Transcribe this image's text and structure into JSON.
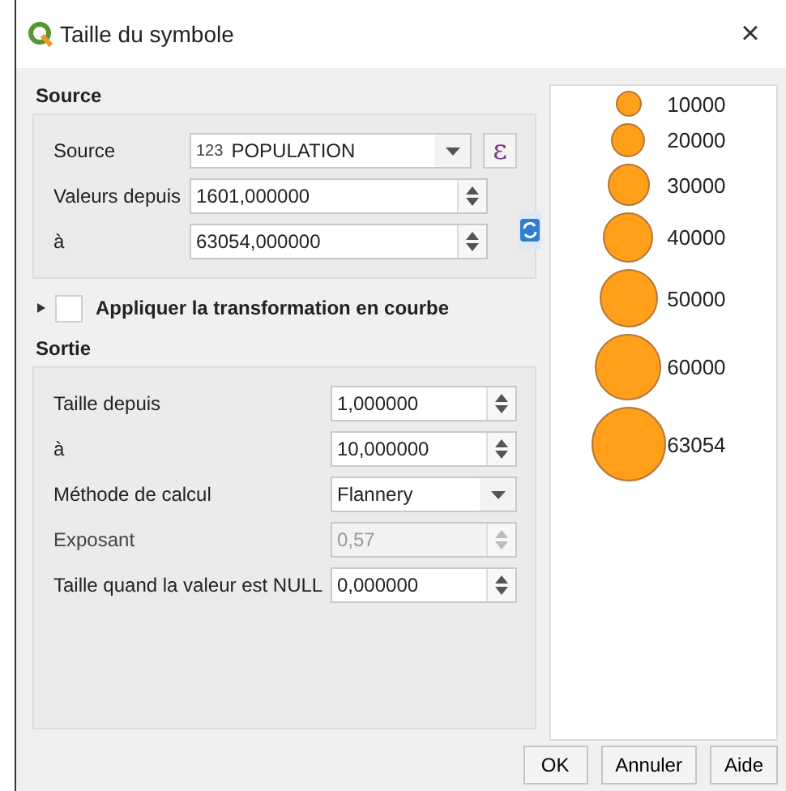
{
  "window": {
    "title": "Taille du symbole",
    "close": "×"
  },
  "source_section": {
    "title": "Source",
    "rows": [
      {
        "kind": "combo",
        "label": "Source",
        "badge": "123",
        "value": "POPULATION",
        "disabled": false
      },
      {
        "kind": "spin",
        "label": "Valeurs depuis",
        "value": "1601,000000",
        "disabled": false
      },
      {
        "kind": "spin",
        "label": "à",
        "value": "63054,000000",
        "disabled": false
      }
    ],
    "expression_button": "ε"
  },
  "curve": {
    "label": "Appliquer la transformation en courbe",
    "checked": false,
    "expanded": false
  },
  "output_section": {
    "title": "Sortie",
    "rows": [
      {
        "kind": "spin",
        "label": "Taille depuis",
        "value": "1,000000",
        "disabled": false
      },
      {
        "kind": "spin",
        "label": "à",
        "value": "10,000000",
        "disabled": false
      },
      {
        "kind": "combo",
        "label": "Méthode de calcul",
        "value": "Flannery",
        "disabled": false
      },
      {
        "kind": "spin",
        "label": "Exposant",
        "value": "0,57",
        "disabled": true
      },
      {
        "kind": "spin",
        "label": "Taille quand la valeur est NULL",
        "value": "0,000000",
        "disabled": false
      }
    ]
  },
  "legend": [
    {
      "label": "10000"
    },
    {
      "label": "20000"
    },
    {
      "label": "30000"
    },
    {
      "label": "40000"
    },
    {
      "label": "50000"
    },
    {
      "label": "60000"
    },
    {
      "label": "63054"
    }
  ],
  "buttons": [
    "OK",
    "Annuler",
    "Aide"
  ]
}
